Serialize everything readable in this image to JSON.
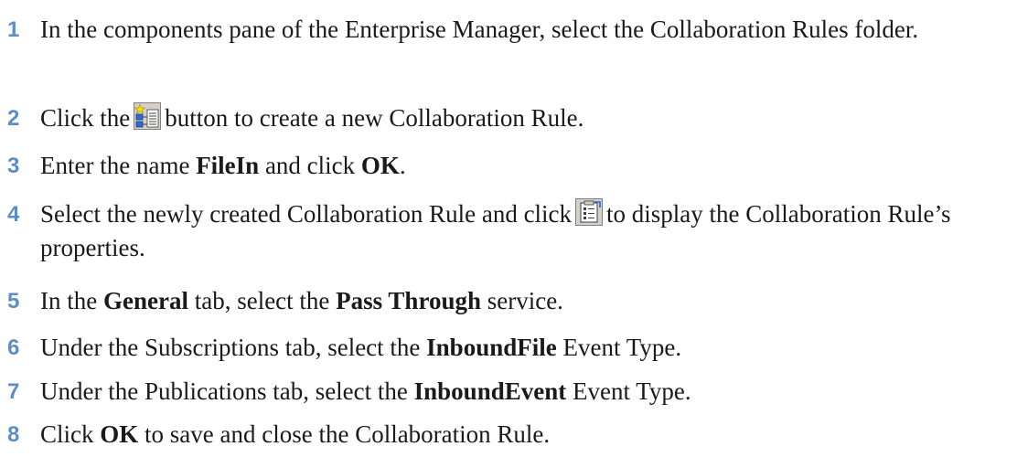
{
  "steps": [
    {
      "num": "1",
      "text": "In the components pane of the Enterprise Manager, select the Collaboration Rules folder."
    },
    {
      "num": "2",
      "a": "Click the",
      "icon": "new-collaboration-rule-icon",
      "b": "button to create a new Collaboration Rule."
    },
    {
      "num": "3",
      "a": "Enter the name ",
      "bold1": "FileIn",
      "b": " and click ",
      "bold2": "OK",
      "c": "."
    },
    {
      "num": "4",
      "a": "Select the newly created Collaboration Rule and click",
      "icon": "properties-icon",
      "b": "to display the Collaboration Rule’s properties."
    },
    {
      "num": "5",
      "a": "In the ",
      "bold1": "General",
      "b": " tab, select the ",
      "bold2": "Pass Through",
      "c": " service."
    },
    {
      "num": "6",
      "a": "Under the Subscriptions tab, select the ",
      "bold1": "InboundFile",
      "b": " Event Type."
    },
    {
      "num": "7",
      "a": "Under the Publications tab, select the ",
      "bold1": "InboundEvent",
      "b": " Event Type."
    },
    {
      "num": "8",
      "a": "Click ",
      "bold1": "OK",
      "b": " to save and close the Collaboration Rule."
    }
  ],
  "colors": {
    "step_number": "#5c8ec4",
    "text": "#1a1a1a"
  }
}
